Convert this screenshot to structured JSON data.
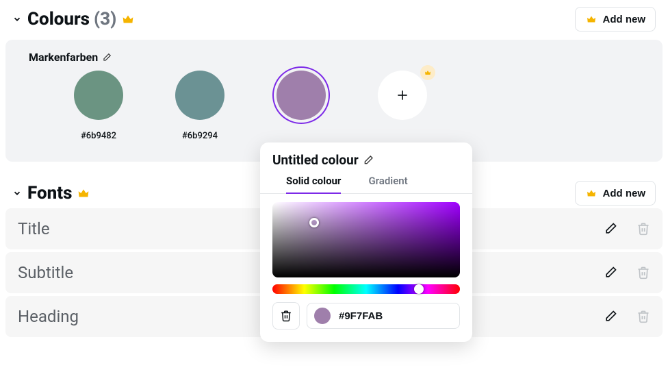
{
  "colours": {
    "title": "Colours",
    "count": "(3)",
    "add_label": "Add new",
    "palette_name": "Markenfarben",
    "swatches": [
      {
        "hex": "#6b9482",
        "css": "#6b9482"
      },
      {
        "hex": "#6b9294",
        "css": "#6b9294"
      },
      {
        "hex": "",
        "css": "#9F7FAB"
      }
    ]
  },
  "fonts": {
    "title": "Fonts",
    "count": "",
    "add_label": "Add new",
    "items": [
      {
        "name": "Title"
      },
      {
        "name": "Subtitle"
      },
      {
        "name": "Heading"
      }
    ]
  },
  "picker": {
    "title": "Untitled colour",
    "tab_solid": "Solid colour",
    "tab_gradient": "Gradient",
    "hex": "#9F7FAB",
    "swatch_css": "#9F7FAB"
  }
}
